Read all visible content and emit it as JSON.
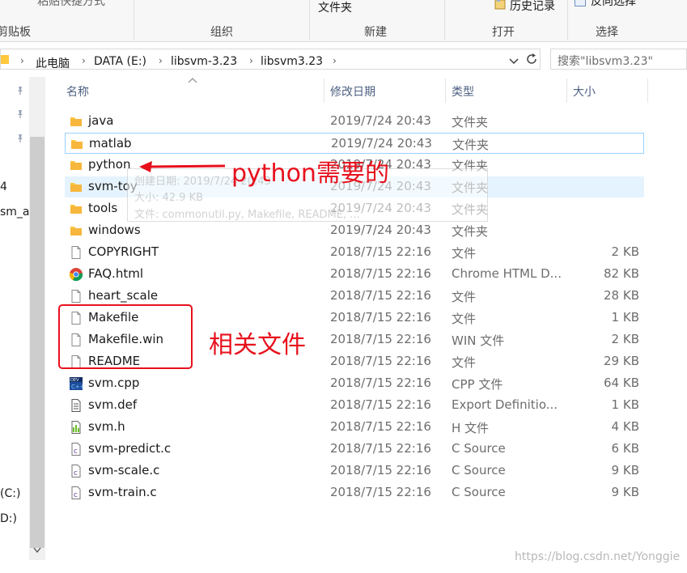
{
  "ribbon": {
    "top_items": [
      "粘贴快捷方式",
      "文件夹",
      "历史记录",
      "反向选择"
    ],
    "groups": [
      "剪贴板",
      "组织",
      "新建",
      "打开",
      "选择"
    ]
  },
  "address": {
    "path": [
      "此电脑",
      "DATA (E:)",
      "libsvm-3.23",
      "libsvm3.23"
    ],
    "search_placeholder": "搜索\"libsvm3.23\""
  },
  "nav": {
    "items": [
      "4",
      "sm_a",
      "(C:)",
      "D:)"
    ]
  },
  "columns": [
    "名称",
    "修改日期",
    "类型",
    "大小"
  ],
  "files": [
    {
      "name": "java",
      "date": "2019/7/24 20:43",
      "type": "文件夹",
      "size": "",
      "icon": "folder-icon"
    },
    {
      "name": "matlab",
      "date": "2019/7/24 20:43",
      "type": "文件夹",
      "size": "",
      "icon": "folder-icon"
    },
    {
      "name": "python",
      "date": "2019/7/24 20:43",
      "type": "文件夹",
      "size": "",
      "icon": "folder-icon"
    },
    {
      "name": "svm-toy",
      "date": "2019/7/24 20:43",
      "type": "文件夹",
      "size": "",
      "icon": "folder-icon"
    },
    {
      "name": "tools",
      "date": "2019/7/24 20:43",
      "type": "文件夹",
      "size": "",
      "icon": "folder-icon"
    },
    {
      "name": "windows",
      "date": "2019/7/24 20:43",
      "type": "文件夹",
      "size": "",
      "icon": "folder-icon"
    },
    {
      "name": "COPYRIGHT",
      "date": "2018/7/15 22:16",
      "type": "文件",
      "size": "2 KB",
      "icon": "file-icon"
    },
    {
      "name": "FAQ.html",
      "date": "2018/7/15 22:16",
      "type": "Chrome HTML D...",
      "size": "82 KB",
      "icon": "chrome-icon"
    },
    {
      "name": "heart_scale",
      "date": "2018/7/15 22:16",
      "type": "文件",
      "size": "28 KB",
      "icon": "file-icon"
    },
    {
      "name": "Makefile",
      "date": "2018/7/15 22:16",
      "type": "文件",
      "size": "1 KB",
      "icon": "file-icon"
    },
    {
      "name": "Makefile.win",
      "date": "2018/7/15 22:16",
      "type": "WIN 文件",
      "size": "2 KB",
      "icon": "file-icon"
    },
    {
      "name": "README",
      "date": "2018/7/15 22:16",
      "type": "文件",
      "size": "29 KB",
      "icon": "file-icon"
    },
    {
      "name": "svm.cpp",
      "date": "2018/7/15 22:16",
      "type": "CPP 文件",
      "size": "64 KB",
      "icon": "devcpp-icon"
    },
    {
      "name": "svm.def",
      "date": "2018/7/15 22:16",
      "type": "Export Definitio...",
      "size": "1 KB",
      "icon": "def-file-icon"
    },
    {
      "name": "svm.h",
      "date": "2018/7/15 22:16",
      "type": "H 文件",
      "size": "4 KB",
      "icon": "header-file-icon"
    },
    {
      "name": "svm-predict.c",
      "date": "2018/7/15 22:16",
      "type": "C Source",
      "size": "6 KB",
      "icon": "c-source-icon"
    },
    {
      "name": "svm-scale.c",
      "date": "2018/7/15 22:16",
      "type": "C Source",
      "size": "9 KB",
      "icon": "c-source-icon"
    },
    {
      "name": "svm-train.c",
      "date": "2018/7/15 22:16",
      "type": "C Source",
      "size": "9 KB",
      "icon": "c-source-icon"
    }
  ],
  "tooltip": {
    "lines": [
      "创建日期: 2019/7/24 20:43",
      "大小: 42.9 KB",
      "文件: commonutil.py, Makefile, README, ..."
    ]
  },
  "annotations": {
    "python_note": "python需要的",
    "files_note": "相关文件",
    "color": "#e8101d"
  },
  "watermark": "https://blog.csdn.net/Yonggie",
  "colors": {
    "folder": "#ffc83d",
    "selection": "#e5f3ff",
    "selection_border": "#99d1ff",
    "header_text": "#4d6082"
  }
}
